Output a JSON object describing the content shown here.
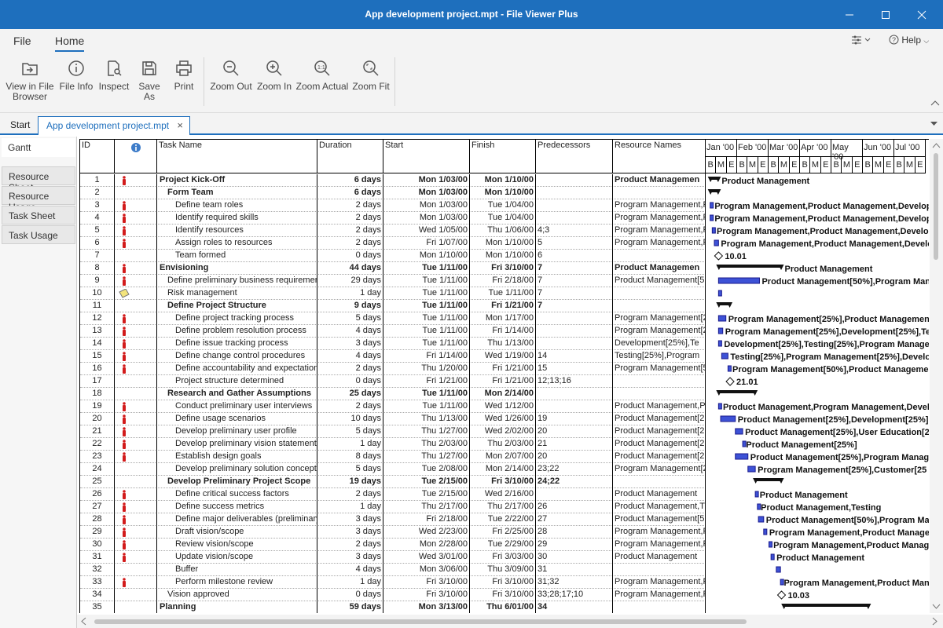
{
  "window": {
    "title": "App development project.mpt - File Viewer Plus"
  },
  "menu": {
    "file": "File",
    "home": "Home",
    "help": "Help"
  },
  "ribbon": {
    "buttons": [
      {
        "id": "view-in-file-browser",
        "label": "View in File Browser",
        "icon": "open-folder-icon"
      },
      {
        "id": "file-info",
        "label": "File Info",
        "icon": "info-icon"
      },
      {
        "id": "inspect",
        "label": "Inspect",
        "icon": "inspect-icon"
      },
      {
        "id": "save-as",
        "label": "Save As",
        "icon": "save-icon"
      },
      {
        "id": "print",
        "label": "Print",
        "icon": "printer-icon"
      },
      {
        "id": "zoom-out",
        "label": "Zoom Out",
        "icon": "zoom-out-icon"
      },
      {
        "id": "zoom-in",
        "label": "Zoom In",
        "icon": "zoom-in-icon"
      },
      {
        "id": "zoom-actual",
        "label": "Zoom Actual",
        "icon": "zoom-actual-icon"
      },
      {
        "id": "zoom-fit",
        "label": "Zoom Fit",
        "icon": "zoom-fit-icon"
      }
    ]
  },
  "doc_tabs": {
    "start": "Start",
    "active": "App development project.mpt"
  },
  "views": [
    "Gantt",
    "Resource Sheet",
    "Resource Usage",
    "Task Sheet",
    "Task Usage"
  ],
  "active_view": "Gantt",
  "columns": {
    "id": "ID",
    "task_name": "Task Name",
    "duration": "Duration",
    "start": "Start",
    "finish": "Finish",
    "predecessors": "Predecessors",
    "resource_names": "Resource Names"
  },
  "months": [
    "Jan '00",
    "Feb '00",
    "Mar '00",
    "Apr '00",
    "May '00",
    "Jun '00",
    "Jul '00"
  ],
  "week_letters": [
    "B",
    "M",
    "E"
  ],
  "tasks": [
    {
      "id": "1",
      "ind": "person",
      "name": "Project Kick-Off",
      "level": 0,
      "summary": true,
      "dur": "6 days",
      "start": "Mon 1/03/00",
      "finish": "Mon 1/10/00",
      "pred": "",
      "res": "Product Managemen",
      "bar": "Product Management"
    },
    {
      "id": "2",
      "ind": "",
      "name": "Form Team",
      "level": 1,
      "summary": true,
      "dur": "6 days",
      "start": "Mon 1/03/00",
      "finish": "Mon 1/10/00",
      "pred": "",
      "res": "",
      "bar": ""
    },
    {
      "id": "3",
      "ind": "person",
      "name": "Define team roles",
      "level": 2,
      "summary": false,
      "dur": "2 days",
      "start": "Mon 1/03/00",
      "finish": "Tue 1/04/00",
      "pred": "",
      "res": "Program Management,P",
      "bar": "Program Management,Product Management,Develop"
    },
    {
      "id": "4",
      "ind": "person",
      "name": "Identify required skills",
      "level": 2,
      "summary": false,
      "dur": "2 days",
      "start": "Mon 1/03/00",
      "finish": "Tue 1/04/00",
      "pred": "",
      "res": "Program Management,P",
      "bar": "Program Management,Product Management,Develop"
    },
    {
      "id": "5",
      "ind": "person",
      "name": "Identify resources",
      "level": 2,
      "summary": false,
      "dur": "2 days",
      "start": "Wed 1/05/00",
      "finish": "Thu 1/06/00",
      "pred": "4;3",
      "res": "Program Management,P",
      "bar": "Program Management,Product Management,Develo"
    },
    {
      "id": "6",
      "ind": "person",
      "name": "Assign roles to resources",
      "level": 2,
      "summary": false,
      "dur": "2 days",
      "start": "Fri 1/07/00",
      "finish": "Mon 1/10/00",
      "pred": "5",
      "res": "Program Management,P",
      "bar": "Program Management,Product Management,Develo"
    },
    {
      "id": "7",
      "ind": "",
      "name": "Team formed",
      "level": 2,
      "summary": false,
      "dur": "0 days",
      "start": "Mon 1/10/00",
      "finish": "Mon 1/10/00",
      "pred": "6",
      "res": "",
      "bar": "10.01"
    },
    {
      "id": "8",
      "ind": "person",
      "name": "Envisioning",
      "level": 0,
      "summary": true,
      "dur": "44 days",
      "start": "Tue 1/11/00",
      "finish": "Fri 3/10/00",
      "pred": "7",
      "res": "Product Managemen",
      "bar": "Product Management"
    },
    {
      "id": "9",
      "ind": "person",
      "name": "Define preliminary business requiremen",
      "level": 1,
      "summary": false,
      "dur": "29 days",
      "start": "Tue 1/11/00",
      "finish": "Fri 2/18/00",
      "pred": "7",
      "res": "Product Management[5",
      "bar": "Product Management[50%],Program Man"
    },
    {
      "id": "10",
      "ind": "note",
      "name": "Risk management",
      "level": 1,
      "summary": false,
      "dur": "1 day",
      "start": "Tue 1/11/00",
      "finish": "Tue 1/11/00",
      "pred": "7",
      "res": "",
      "bar": ""
    },
    {
      "id": "11",
      "ind": "",
      "name": "Define Project Structure",
      "level": 1,
      "summary": true,
      "dur": "9 days",
      "start": "Tue 1/11/00",
      "finish": "Fri 1/21/00",
      "pred": "7",
      "res": "",
      "bar": ""
    },
    {
      "id": "12",
      "ind": "person",
      "name": "Define project tracking process",
      "level": 2,
      "summary": false,
      "dur": "5 days",
      "start": "Tue 1/11/00",
      "finish": "Mon 1/17/00",
      "pred": "",
      "res": "Program Management[2",
      "bar": "Program Management[25%],Product Management"
    },
    {
      "id": "13",
      "ind": "person",
      "name": "Define problem resolution process",
      "level": 2,
      "summary": false,
      "dur": "4 days",
      "start": "Tue 1/11/00",
      "finish": "Fri 1/14/00",
      "pred": "",
      "res": "Program Management[2",
      "bar": "Program Management[25%],Development[25%],Te"
    },
    {
      "id": "14",
      "ind": "person",
      "name": "Define issue tracking process",
      "level": 2,
      "summary": false,
      "dur": "3 days",
      "start": "Tue 1/11/00",
      "finish": "Thu 1/13/00",
      "pred": "",
      "res": "Development[25%],Te",
      "bar": "Development[25%],Testing[25%],Program Manage"
    },
    {
      "id": "15",
      "ind": "person",
      "name": "Define change control procedures",
      "level": 2,
      "summary": false,
      "dur": "4 days",
      "start": "Fri 1/14/00",
      "finish": "Wed 1/19/00",
      "pred": "14",
      "res": "Testing[25%],Program",
      "bar": "Testing[25%],Program Management[25%],Develo"
    },
    {
      "id": "16",
      "ind": "person",
      "name": "Define accountability and expectation",
      "level": 2,
      "summary": false,
      "dur": "2 days",
      "start": "Thu 1/20/00",
      "finish": "Fri 1/21/00",
      "pred": "15",
      "res": "Program Management[5",
      "bar": "Program Management[50%],Product Managemen"
    },
    {
      "id": "17",
      "ind": "",
      "name": "Project structure determined",
      "level": 2,
      "summary": false,
      "dur": "0 days",
      "start": "Fri 1/21/00",
      "finish": "Fri 1/21/00",
      "pred": "12;13;16",
      "res": "",
      "bar": "21.01"
    },
    {
      "id": "18",
      "ind": "",
      "name": "Research and Gather Assumptions",
      "level": 1,
      "summary": true,
      "dur": "25 days",
      "start": "Tue 1/11/00",
      "finish": "Mon 2/14/00",
      "pred": "",
      "res": "",
      "bar": ""
    },
    {
      "id": "19",
      "ind": "person",
      "name": "Conduct preliminary user interviews",
      "level": 2,
      "summary": false,
      "dur": "2 days",
      "start": "Tue 1/11/00",
      "finish": "Wed 1/12/00",
      "pred": "",
      "res": "Product Management,P",
      "bar": "Product Management,Program Management,Develo"
    },
    {
      "id": "20",
      "ind": "person",
      "name": "Define usage scenarios",
      "level": 2,
      "summary": false,
      "dur": "10 days",
      "start": "Thu 1/13/00",
      "finish": "Wed 1/26/00",
      "pred": "19",
      "res": "Product Management[2",
      "bar": "Product Management[25%],Development[25%]"
    },
    {
      "id": "21",
      "ind": "person",
      "name": "Develop preliminary user profile",
      "level": 2,
      "summary": false,
      "dur": "5 days",
      "start": "Thu 1/27/00",
      "finish": "Wed 2/02/00",
      "pred": "20",
      "res": "Product Management[2",
      "bar": "Product Management[25%],User Education[25"
    },
    {
      "id": "22",
      "ind": "person",
      "name": "Develop preliminary vision statement",
      "level": 2,
      "summary": false,
      "dur": "1 day",
      "start": "Thu 2/03/00",
      "finish": "Thu 2/03/00",
      "pred": "21",
      "res": "Product Management[2",
      "bar": "Product Management[25%]"
    },
    {
      "id": "23",
      "ind": "person",
      "name": "Establish design goals",
      "level": 2,
      "summary": false,
      "dur": "8 days",
      "start": "Thu 1/27/00",
      "finish": "Mon 2/07/00",
      "pred": "20",
      "res": "Product Management[2",
      "bar": "Product Management[25%],Program Manag"
    },
    {
      "id": "24",
      "ind": "",
      "name": "Develop preliminary solution concept",
      "level": 2,
      "summary": false,
      "dur": "5 days",
      "start": "Tue 2/08/00",
      "finish": "Mon 2/14/00",
      "pred": "23;22",
      "res": "Program Management[2",
      "bar": "Program Management[25%],Customer[25"
    },
    {
      "id": "25",
      "ind": "",
      "name": "Develop Preliminary Project Scope",
      "level": 1,
      "summary": true,
      "dur": "19 days",
      "start": "Tue 2/15/00",
      "finish": "Fri 3/10/00",
      "pred": "24;22",
      "res": "",
      "bar": ""
    },
    {
      "id": "26",
      "ind": "person",
      "name": "Define critical success factors",
      "level": 2,
      "summary": false,
      "dur": "2 days",
      "start": "Tue 2/15/00",
      "finish": "Wed 2/16/00",
      "pred": "",
      "res": "Product Management",
      "bar": "Product Management"
    },
    {
      "id": "27",
      "ind": "person",
      "name": "Define success metrics",
      "level": 2,
      "summary": false,
      "dur": "1 day",
      "start": "Thu 2/17/00",
      "finish": "Thu 2/17/00",
      "pred": "26",
      "res": "Product Management,T",
      "bar": "Product Management,Testing"
    },
    {
      "id": "28",
      "ind": "person",
      "name": "Define major deliverables (preliminary",
      "level": 2,
      "summary": false,
      "dur": "3 days",
      "start": "Fri 2/18/00",
      "finish": "Tue 2/22/00",
      "pred": "27",
      "res": "Product Management[5",
      "bar": "Product Management[50%],Program Man"
    },
    {
      "id": "29",
      "ind": "person",
      "name": "Draft vision/scope",
      "level": 2,
      "summary": false,
      "dur": "3 days",
      "start": "Wed 2/23/00",
      "finish": "Fri 2/25/00",
      "pred": "28",
      "res": "Program Management,P",
      "bar": "Program Management,Product Manage"
    },
    {
      "id": "30",
      "ind": "person",
      "name": "Review vision/scope",
      "level": 2,
      "summary": false,
      "dur": "2 days",
      "start": "Mon 2/28/00",
      "finish": "Tue 2/29/00",
      "pred": "29",
      "res": "Program Management,P",
      "bar": "Program Management,Product Manag"
    },
    {
      "id": "31",
      "ind": "person",
      "name": "Update vision/scope",
      "level": 2,
      "summary": false,
      "dur": "3 days",
      "start": "Wed 3/01/00",
      "finish": "Fri 3/03/00",
      "pred": "30",
      "res": "Product Management",
      "bar": "Product Management"
    },
    {
      "id": "32",
      "ind": "",
      "name": "Buffer",
      "level": 2,
      "summary": false,
      "dur": "4 days",
      "start": "Mon 3/06/00",
      "finish": "Thu 3/09/00",
      "pred": "31",
      "res": "",
      "bar": ""
    },
    {
      "id": "33",
      "ind": "person",
      "name": "Perform milestone review",
      "level": 2,
      "summary": false,
      "dur": "1 day",
      "start": "Fri 3/10/00",
      "finish": "Fri 3/10/00",
      "pred": "31;32",
      "res": "Program Management,P",
      "bar": "Program Management,Product Man"
    },
    {
      "id": "34",
      "ind": "",
      "name": "Vision approved",
      "level": 1,
      "summary": false,
      "dur": "0 days",
      "start": "Fri 3/10/00",
      "finish": "Fri 3/10/00",
      "pred": "33;28;17;10",
      "res": "Program Management,P",
      "bar": "10.03"
    },
    {
      "id": "35",
      "ind": "",
      "name": "Planning",
      "level": 0,
      "summary": true,
      "dur": "59 days",
      "start": "Mon 3/13/00",
      "finish": "Thu 6/01/00",
      "pred": "34",
      "res": "",
      "bar": ""
    }
  ]
}
